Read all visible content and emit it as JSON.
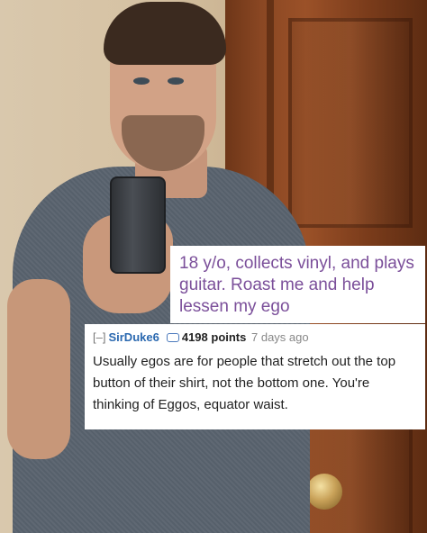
{
  "post": {
    "title": "18 y/o, collects vinyl, and plays guitar. Roast me and help lessen my ego"
  },
  "comment": {
    "collapse_label": "[–]",
    "author": "SirDuke6",
    "points": "4198 points",
    "age": "7 days ago",
    "body": "Usually egos are for people that stretch out the top button of their shirt, not the bottom one. You're thinking of Eggos, equator waist."
  },
  "colors": {
    "title_text": "#7b4f9a",
    "author_link": "#2b69b0",
    "panel_background": "#ffffff"
  }
}
